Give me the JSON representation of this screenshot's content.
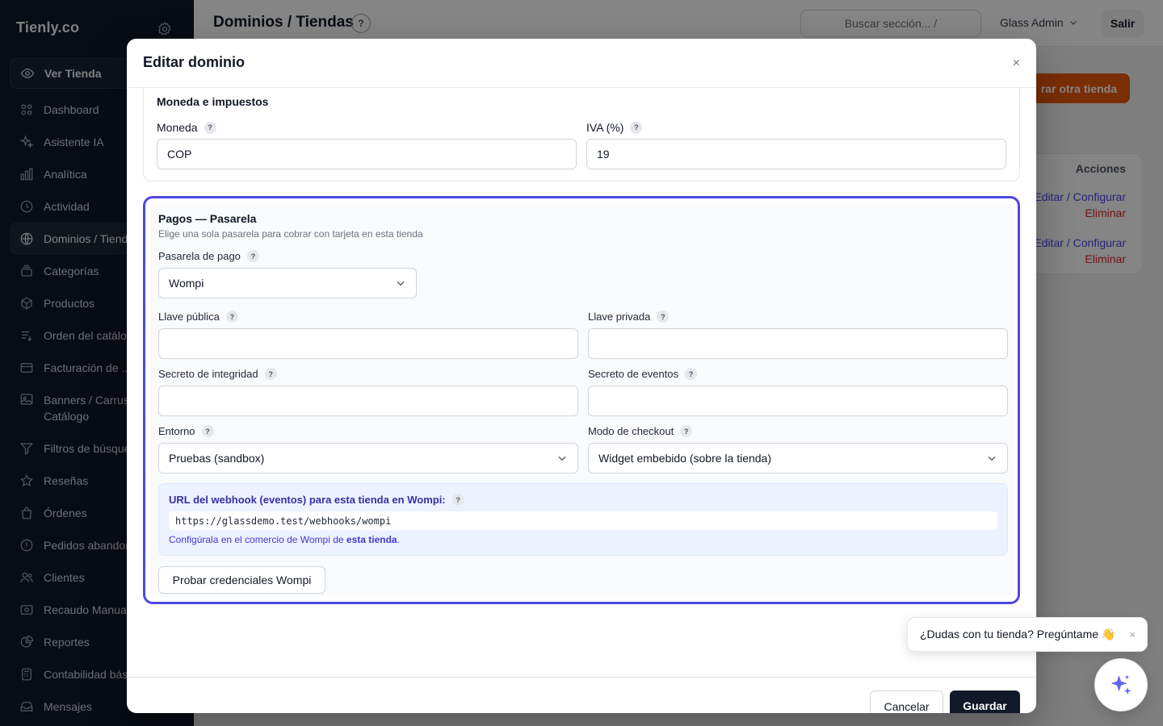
{
  "sidebar": {
    "brand": "Tienly.co",
    "view_store": "Ver Tienda",
    "items": [
      {
        "label": "Dashboard",
        "icon": "grid-icon"
      },
      {
        "label": "Asistente IA",
        "icon": "sparkles-icon"
      },
      {
        "label": "Analítica",
        "icon": "bar-chart-icon"
      },
      {
        "label": "Actividad",
        "icon": "clock-icon"
      },
      {
        "label": "Dominios / Tiendas",
        "icon": "globe-icon",
        "active": true
      },
      {
        "label": "Categorías",
        "icon": "layers-icon"
      },
      {
        "label": "Productos",
        "icon": "box-icon"
      },
      {
        "label": "Orden del catálogo",
        "icon": "sort-list-icon"
      },
      {
        "label": "Facturación de ...",
        "icon": "credit-card-icon"
      },
      {
        "label": "Banners / Carrusel Catálogo",
        "icon": "image-icon"
      },
      {
        "label": "Filtros de búsqueda",
        "icon": "filter-icon"
      },
      {
        "label": "Reseñas",
        "icon": "star-icon"
      },
      {
        "label": "Órdenes",
        "icon": "shopping-bag-icon"
      },
      {
        "label": "Pedidos abandonados",
        "icon": "alert-circle-icon"
      },
      {
        "label": "Clientes",
        "icon": "users-icon"
      },
      {
        "label": "Recaudo Manual",
        "icon": "cash-icon"
      },
      {
        "label": "Reportes",
        "icon": "pie-chart-icon"
      },
      {
        "label": "Contabilidad básica",
        "icon": "calculator-icon"
      },
      {
        "label": "Mensajes",
        "icon": "inbox-icon"
      }
    ]
  },
  "topbar": {
    "title": "Dominios / Tiendas",
    "help": "?",
    "search_placeholder": "Buscar sección...  /",
    "user": "Glass Admin",
    "logout": "Salir"
  },
  "background": {
    "primary_button": "rar otra tienda",
    "actions_header": "Acciones",
    "row_actions": [
      {
        "edit": "Editar / Configurar",
        "delete": "Eliminar"
      },
      {
        "edit": "Editar / Configurar",
        "delete": "Eliminar"
      }
    ]
  },
  "modal": {
    "title": "Editar dominio",
    "close": "×",
    "currency_section": {
      "title": "Moneda e impuestos",
      "currency_label": "Moneda",
      "currency_value": "COP",
      "vat_label": "IVA (%)",
      "vat_value": "19"
    },
    "payments_section": {
      "title": "Pagos — Pasarela",
      "subtitle": "Elige una sola pasarela para cobrar con tarjeta en esta tienda",
      "gateway_label": "Pasarela de pago",
      "gateway_value": "Wompi",
      "public_key_label": "Llave pública",
      "public_key_value": "",
      "private_key_label": "Llave privada",
      "private_key_value": "",
      "integrity_secret_label": "Secreto de integridad",
      "integrity_secret_value": "",
      "events_secret_label": "Secreto de eventos",
      "events_secret_value": "",
      "environment_label": "Entorno",
      "environment_value": "Pruebas (sandbox)",
      "checkout_mode_label": "Modo de checkout",
      "checkout_mode_value": "Widget embebido (sobre la tienda)",
      "webhook": {
        "title": "URL del webhook (eventos) para esta tienda en Wompi:",
        "url": "https://glassdemo.test/webhooks/wompi",
        "note_prefix": "Configúrala en el comercio de Wompi de ",
        "note_bold": "esta tienda",
        "note_suffix": "."
      },
      "test_button": "Probar credenciales Wompi"
    },
    "footer": {
      "cancel": "Cancelar",
      "save": "Guardar"
    }
  },
  "chat": {
    "bubble": "¿Dudas con tu tienda? Pregúntame 👋",
    "close": "×"
  },
  "colors": {
    "sidebar_bg": "#101828",
    "accent": "#4f46e5",
    "orange": "#ea580c",
    "danger": "#dc2626"
  }
}
